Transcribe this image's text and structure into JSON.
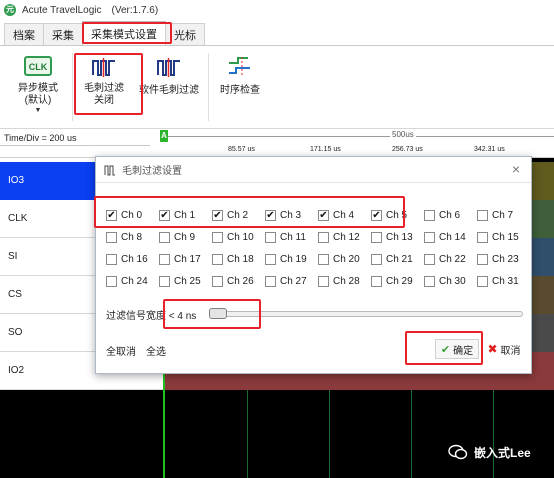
{
  "window": {
    "title": "Acute TravelLogic",
    "version": "(Ver:1.7.6)",
    "app_icon_glyph": "元"
  },
  "tabs": [
    {
      "label": "档案",
      "active": false
    },
    {
      "label": "采集",
      "active": false
    },
    {
      "label": "采集模式设置",
      "active": true
    },
    {
      "label": "光标",
      "active": false
    }
  ],
  "ribbon": {
    "async_mode": {
      "line1": "异步模式",
      "line2": "(默认)",
      "icon": "clk-icon"
    },
    "glitch_filter": {
      "line1": "毛刺过滤",
      "line2": "关闭",
      "icon": "glitch-filter-icon"
    },
    "software_glitch_filter": {
      "label": "软件毛刺过滤",
      "icon": "software-glitch-filter-icon"
    },
    "timing_check": {
      "label": "时序检查",
      "icon": "timing-check-icon"
    }
  },
  "timebar": {
    "time_div": "Time/Div = 200 us",
    "marker_label": "A",
    "span_label": "500us",
    "ticks": [
      "85.57 us",
      "171.15 us",
      "256.73 us",
      "342.31 us"
    ]
  },
  "signals": [
    {
      "name": "IO3",
      "selected": true
    },
    {
      "name": "CLK",
      "selected": false
    },
    {
      "name": "SI",
      "selected": false
    },
    {
      "name": "CS",
      "selected": false
    },
    {
      "name": "SO",
      "selected": false
    },
    {
      "name": "IO2",
      "selected": false
    }
  ],
  "dialog": {
    "title": "毛刺过滤设置",
    "channels": [
      {
        "label": "Ch 0",
        "checked": true
      },
      {
        "label": "Ch 1",
        "checked": true
      },
      {
        "label": "Ch 2",
        "checked": true
      },
      {
        "label": "Ch 3",
        "checked": true
      },
      {
        "label": "Ch 4",
        "checked": true
      },
      {
        "label": "Ch 5",
        "checked": true
      },
      {
        "label": "Ch 6",
        "checked": false
      },
      {
        "label": "Ch 7",
        "checked": false
      },
      {
        "label": "Ch 8",
        "checked": false
      },
      {
        "label": "Ch 9",
        "checked": false
      },
      {
        "label": "Ch 10",
        "checked": false
      },
      {
        "label": "Ch 11",
        "checked": false
      },
      {
        "label": "Ch 12",
        "checked": false
      },
      {
        "label": "Ch 13",
        "checked": false
      },
      {
        "label": "Ch 14",
        "checked": false
      },
      {
        "label": "Ch 15",
        "checked": false
      },
      {
        "label": "Ch 16",
        "checked": false
      },
      {
        "label": "Ch 17",
        "checked": false
      },
      {
        "label": "Ch 18",
        "checked": false
      },
      {
        "label": "Ch 19",
        "checked": false
      },
      {
        "label": "Ch 20",
        "checked": false
      },
      {
        "label": "Ch 21",
        "checked": false
      },
      {
        "label": "Ch 22",
        "checked": false
      },
      {
        "label": "Ch 23",
        "checked": false
      },
      {
        "label": "Ch 24",
        "checked": false
      },
      {
        "label": "Ch 25",
        "checked": false
      },
      {
        "label": "Ch 26",
        "checked": false
      },
      {
        "label": "Ch 27",
        "checked": false
      },
      {
        "label": "Ch 28",
        "checked": false
      },
      {
        "label": "Ch 29",
        "checked": false
      },
      {
        "label": "Ch 30",
        "checked": false
      },
      {
        "label": "Ch 31",
        "checked": false
      }
    ],
    "filter_width_label": "过滤信号宽度 < 4 ns",
    "slider_level": 0,
    "deselect_all": "全取消",
    "select_all": "全选",
    "ok": "确定",
    "cancel": "取消"
  },
  "watermark": {
    "text": "嵌入式Lee",
    "icon": "wechat-icon"
  },
  "colors": {
    "selected_signal": "#0a3ff2",
    "highlight_box": "#e8202a",
    "cursor_marker": "#22c020",
    "ok_icon": "#3aa33a",
    "cancel_icon": "#e02020"
  }
}
